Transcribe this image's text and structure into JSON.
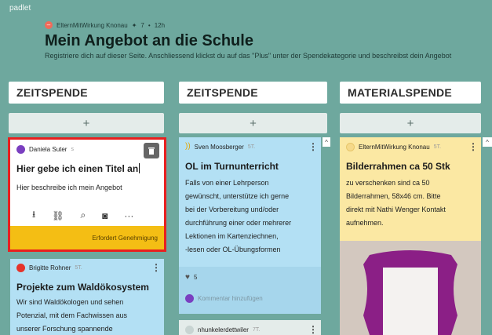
{
  "brand": "padlet",
  "header": {
    "author": "ElternMitWirkung Knonau",
    "likes": "7",
    "time": "12h",
    "title": "Mein Angebot an die Schule",
    "subtitle": "Registriere dich auf dieser Seite. Anschliessend klickst du auf das \"Plus\" unter der Spendekategorie und beschreibst dein Angebot"
  },
  "columns": [
    {
      "title": "ZEITSPENDE",
      "add": "+"
    },
    {
      "title": "ZEITSPENDE",
      "add": "+"
    },
    {
      "title": "MATERIALSPENDE",
      "add": "+"
    }
  ],
  "draft": {
    "author": "Daniela Suter",
    "time": "s",
    "title_value": "Hier gebe ich einen Titel an",
    "body_value": "Hier beschreibe ich mein Angebot",
    "status": "Erfordert Genehmigung",
    "highlight_color": "#e8201f"
  },
  "card_brigitte": {
    "author": "Brigitte Rohner",
    "time": "5T.",
    "title": "Projekte zum Waldökosystem",
    "lines": [
      "Wir sind Waldökologen und sehen",
      "Potenzial, mit dem Fachwissen aus",
      "unserer Forschung spannende"
    ]
  },
  "card_sven": {
    "author": "Sven Moosberger",
    "time": "5T.",
    "title": "OL im Turnunterricht",
    "lines": [
      "Falls von einer Lehrperson",
      "gewünscht, unterstütze ich gerne",
      "bei der Vorbereitung und/oder",
      "durchführung einer oder mehrerer",
      "Lektionen im Kartenziechnen,",
      "-lesen oder OL-Übungsformen"
    ],
    "likes": "5",
    "comment_placeholder": "Kommentar hinzufügen"
  },
  "card_nhunke": {
    "author": "nhunkelerdettwiler",
    "time": "7T."
  },
  "card_material": {
    "author": "ElternMitWirkung Knonau",
    "time": "5T.",
    "title": "Bilderrahmen ca 50 Stk",
    "lines": [
      "zu verschenken sind ca 50",
      "Bilderrahmen, 58x46 cm. Bitte",
      "direkt mit Nathi Wenger Kontakt",
      "aufnehmen."
    ]
  },
  "colors": {
    "background": "#6ea89e",
    "card_blue": "#b3e0f4",
    "card_yellow": "#fbe8a3",
    "status_yellow": "#f4be14",
    "frame_purple": "#8b1f86"
  }
}
